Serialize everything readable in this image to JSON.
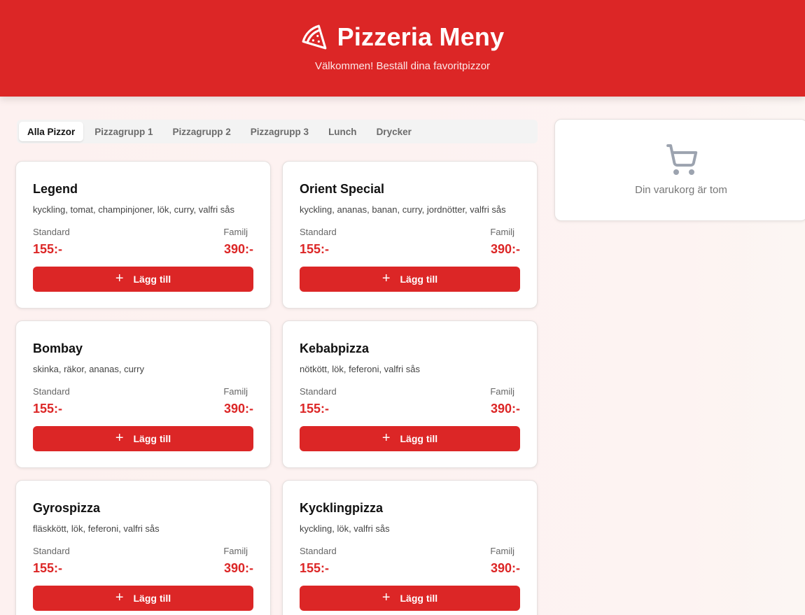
{
  "header": {
    "title": "Pizzeria Meny",
    "subtitle": "Välkommen! Beställ dina favoritpizzor",
    "icon": "pizza-slice-icon",
    "color": "#dc2626"
  },
  "tabs": [
    {
      "label": "Alla Pizzor",
      "active": true
    },
    {
      "label": "Pizzagrupp 1",
      "active": false
    },
    {
      "label": "Pizzagrupp 2",
      "active": false
    },
    {
      "label": "Pizzagrupp 3",
      "active": false
    },
    {
      "label": "Lunch",
      "active": false
    },
    {
      "label": "Drycker",
      "active": false
    }
  ],
  "menu": {
    "standard_label": "Standard",
    "family_label": "Familj",
    "add_label": "Lägg till",
    "items": [
      {
        "name": "Legend",
        "description": "kyckling, tomat, champinjoner, lök, curry, valfri sås",
        "standard_price": "155:-",
        "family_price": "390:-"
      },
      {
        "name": "Orient Special",
        "description": "kyckling, ananas, banan, curry, jordnötter, valfri sås",
        "standard_price": "155:-",
        "family_price": "390:-"
      },
      {
        "name": "Bombay",
        "description": "skinka, räkor, ananas, curry",
        "standard_price": "155:-",
        "family_price": "390:-"
      },
      {
        "name": "Kebabpizza",
        "description": "nötkött, lök, feferoni, valfri sås",
        "standard_price": "155:-",
        "family_price": "390:-"
      },
      {
        "name": "Gyrospizza",
        "description": "fläskkött, lök, feferoni, valfri sås",
        "standard_price": "155:-",
        "family_price": "390:-"
      },
      {
        "name": "Kycklingpizza",
        "description": "kyckling, lök, valfri sås",
        "standard_price": "155:-",
        "family_price": "390:-"
      }
    ]
  },
  "cart": {
    "icon": "shopping-cart-icon",
    "empty_text": "Din varukorg är tom"
  }
}
